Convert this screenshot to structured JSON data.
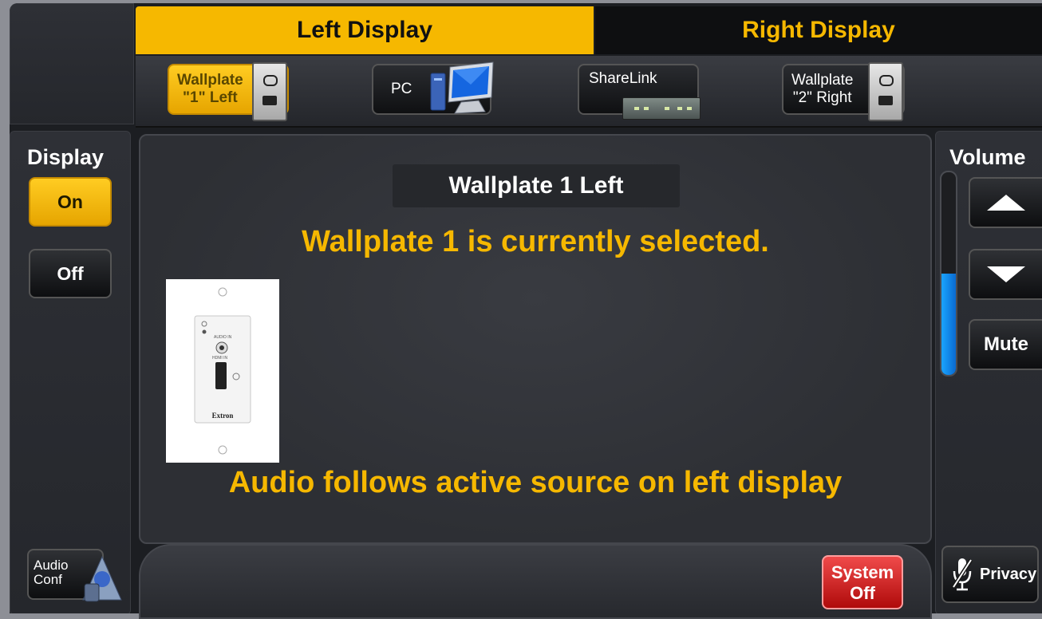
{
  "display_tabs": {
    "left": "Left Display",
    "right": "Right Display",
    "active": "left"
  },
  "sources": [
    {
      "label_line1": "Wallplate",
      "label_line2": "\"1\" Left",
      "icon": "wallplate-connector-icon",
      "active": true
    },
    {
      "label_line1": "PC",
      "label_line2": "",
      "icon": "computer-icon",
      "active": false
    },
    {
      "label_line1": "ShareLink",
      "label_line2": "",
      "icon": "sharelink-device-icon",
      "active": false
    },
    {
      "label_line1": "Wallplate",
      "label_line2": "\"2\" Right",
      "icon": "wallplate-connector-icon",
      "active": false
    }
  ],
  "main": {
    "source_title": "Wallplate 1 Left",
    "status_message": "Wallplate 1 is currently selected.",
    "audio_message": "Audio follows active source on left display",
    "image_icon": "wallplate-hdmi-audio-image",
    "image_brand": "Extron"
  },
  "display_controls": {
    "heading": "Display",
    "on_label": "On",
    "off_label": "Off",
    "active": "on"
  },
  "audio_conf": {
    "label_line1": "Audio",
    "label_line2": "Conf",
    "icon": "conference-phone-icon"
  },
  "volume": {
    "heading": "Volume",
    "level_fraction": 0.5,
    "up_icon": "volume-up-arrow-icon",
    "down_icon": "volume-down-arrow-icon",
    "mute_label": "Mute"
  },
  "privacy": {
    "label": "Privacy",
    "icon": "microphone-muted-icon"
  },
  "system_off": {
    "line1": "System",
    "line2": "Off"
  },
  "colors": {
    "accent": "#f6b800",
    "danger": "#d11a1a",
    "volume_fill": "#1a8cf0"
  }
}
